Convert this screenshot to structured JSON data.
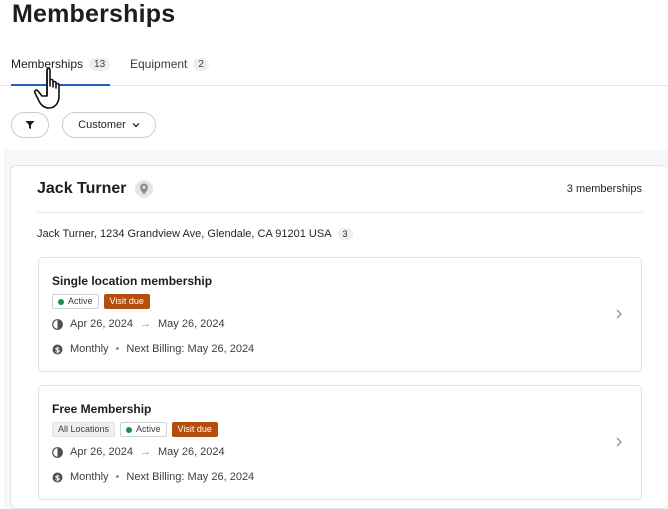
{
  "page": {
    "title": "Memberships"
  },
  "tabs": [
    {
      "label": "Memberships",
      "count": "13",
      "active": true
    },
    {
      "label": "Equipment",
      "count": "2",
      "active": false
    }
  ],
  "filters": {
    "customer_label": "Customer"
  },
  "customer": {
    "name": "Jack Turner",
    "memberships_label": "3 memberships",
    "address": "Jack Turner, 1234 Grandview Ave, Glendale, CA 91201 USA",
    "address_count": "3"
  },
  "memberships": [
    {
      "title": "Single location membership",
      "status": "Active",
      "visit": "Visit due",
      "start": "Apr 26, 2024",
      "arrow": "→",
      "end": "May 26, 2024",
      "frequency": "Monthly",
      "bullet": "•",
      "next_billing": "Next Billing: May 26, 2024"
    },
    {
      "title": "Free Membership",
      "location": "All Locations",
      "status": "Active",
      "visit": "Visit due",
      "start": "Apr 26, 2024",
      "arrow": "→",
      "end": "May 26, 2024",
      "frequency": "Monthly",
      "bullet": "•",
      "next_billing": "Next Billing: May 26, 2024"
    }
  ],
  "colors": {
    "accent": "#1f5fbf",
    "visit_due": "#b54d0c",
    "active_dot": "#1e8c4a"
  },
  "icons": [
    "filter-icon",
    "chevron-down-icon",
    "location-pin-icon",
    "clock-icon",
    "dollar-icon",
    "chevron-right-icon",
    "hand-cursor-icon"
  ]
}
